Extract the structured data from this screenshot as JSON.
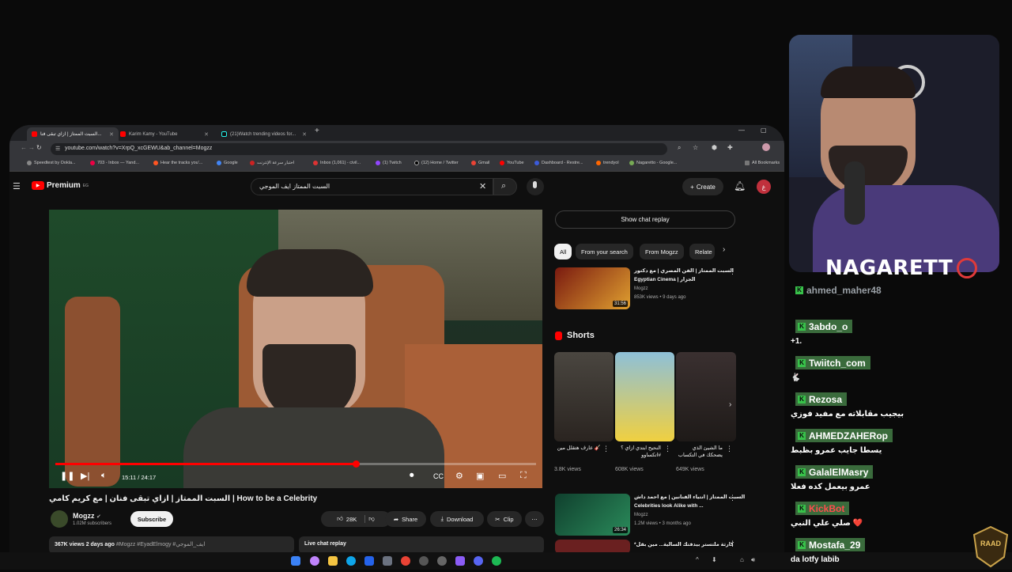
{
  "browser": {
    "tabs": [
      {
        "label": "السبت الممتاز | ازاي تبقى فنا..."
      },
      {
        "label": "Karim Kamy - YouTube"
      },
      {
        "label": "(21)Watch trending videos for..."
      }
    ],
    "url": "youtube.com/watch?v=XrpQ_xcGEWU&ab_channel=Mogzz",
    "bookmarks": [
      "Speedtest by Ookla...",
      "703 - Inbox — Yand...",
      "Hear the tracks you'...",
      "Google",
      "اختبار سرعة الإنترنت",
      "Inbox (1,061) - civil...",
      "(1) Twitch",
      "(12) Home / Twitter",
      "Gmail",
      "YouTube",
      "Dashboard - Restre...",
      "trendyol",
      "Nagaretto - Google...",
      "All Bookmarks"
    ]
  },
  "youtube": {
    "logo_text": "Premium",
    "logo_region": "EG",
    "search_value": "السبت الممتاز ايف الموجي",
    "create_label": "Create",
    "user_avatar_letter": "غ"
  },
  "player": {
    "time": "15:11 / 24:17",
    "progress": 0.625
  },
  "video": {
    "title": "السبت الممتاز | ازاي تبقى فنان | مع كريم كامي | How to be a Celebrity",
    "channel": "Mogzz",
    "subscribers": "1.02M subscribers",
    "subscribe_label": "Subscribe",
    "likes": "28K",
    "share_label": "Share",
    "download_label": "Download",
    "clip_label": "Clip",
    "views_date": "367K views  2 days ago",
    "tags": "#Mogzz #EyadElmogy #ايف_الموجي",
    "live_chat_label": "Live chat replay"
  },
  "sidebar": {
    "show_chat_label": "Show chat replay",
    "chips": [
      "All",
      "From your search",
      "From Mogzz",
      "Relate"
    ],
    "related": [
      {
        "title_1": "السبت الممتاز | الفن المصري | مع دكتور",
        "title_2": "Egyptian Cinema | الجزار",
        "channel": "Mogzz",
        "meta": "853K views • 9 days ago",
        "duration": "31:56"
      },
      {
        "title_1": "السبت الممتاز | انتياء الفنانين | مع احمد داش",
        "title_2": "Celebrities look Alike with ...",
        "channel": "Mogzz",
        "meta": "1.2M views • 3 months ago",
        "duration": "26:34"
      },
      {
        "title_1": "*كارثة ملتستر بيدفتك السالية... مين بقل",
        "title_2": "",
        "channel": "",
        "meta": "",
        "duration": ""
      }
    ],
    "shorts_heading": "Shorts",
    "shorts": [
      {
        "title": "عارف هتقلل مين 🎸",
        "views": "3.8K views"
      },
      {
        "title": "النحيح ابتدي ازاي ؟ #اتكساوو",
        "views": "608K views"
      },
      {
        "title": "ما الشيئ الذي يضحكك في التكساب",
        "views": "649K views"
      }
    ]
  },
  "stream": {
    "name": "NAGARETT",
    "colors": {
      "badge": "#38c14a",
      "highlight": "#3a6b3c",
      "target": "#e03a3a"
    }
  },
  "chat": [
    {
      "user": "ahmed_maher48",
      "message": "",
      "solid": false,
      "color": "#9aa0a6"
    },
    {
      "user": "3abdo_o",
      "message": "+1.",
      "solid": true,
      "color": "#ffffff"
    },
    {
      "user": "Twiitch_com",
      "message": "🐇",
      "solid": true,
      "color": "#ffffff"
    },
    {
      "user": "Rezosa",
      "message": "بيجيب مقابلاته مع مفيد فوزي",
      "solid": true,
      "color": "#ffffff"
    },
    {
      "user": "AHMEDZAHERop",
      "message": "يسطا جايب عمرو بظبط",
      "solid": true,
      "color": "#ffffff"
    },
    {
      "user": "GalalElMasry",
      "message": "عمرو بيعمل كده فعلا",
      "solid": true,
      "color": "#ffffff"
    },
    {
      "user": "KickBot",
      "message": "صلي علي النبي ❤️",
      "solid": true,
      "color": "#ff4d4d"
    },
    {
      "user": "Mostafa_29",
      "message": "da lotfy labib",
      "solid": true,
      "color": "#ffffff"
    }
  ],
  "overlay": {
    "logo_text": "RAAD"
  }
}
